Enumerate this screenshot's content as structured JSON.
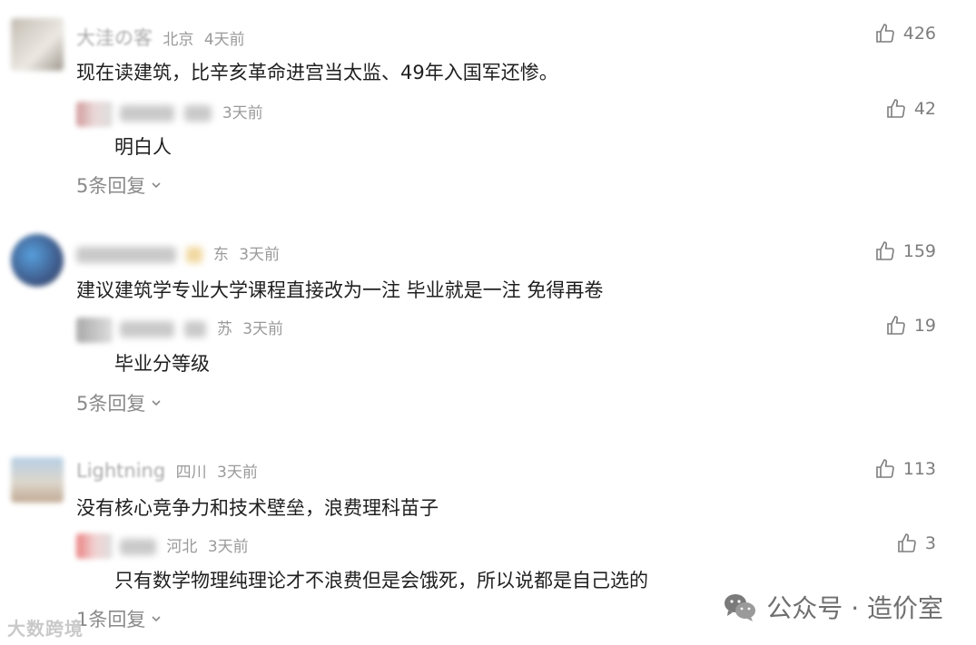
{
  "comments": [
    {
      "user": "大洼の客",
      "location": "北京",
      "time": "4天前",
      "text": "现在读建筑，比辛亥革命进宫当太监、49年入国军还惨。",
      "likes": "426",
      "reply": {
        "location": "",
        "time": "3天前",
        "text": "明白人",
        "likes": "42"
      },
      "more_replies": "5条回复"
    },
    {
      "user": "",
      "location": "东",
      "time": "3天前",
      "text": "建议建筑学专业大学课程直接改为一注 毕业就是一注 免得再卷",
      "likes": "159",
      "reply": {
        "location": "苏",
        "time": "3天前",
        "text": "毕业分等级",
        "likes": "19"
      },
      "more_replies": "5条回复"
    },
    {
      "user": "Lightning",
      "location": "四川",
      "time": "3天前",
      "text": "没有核心竞争力和技术壁垒，浪费理科苗子",
      "likes": "113",
      "reply": {
        "location": "河北",
        "time": "3天前",
        "text": "只有数学物理纯理论才不浪费但是会饿死，所以说都是自己选的",
        "likes": "3"
      },
      "more_replies": "1条回复"
    }
  ],
  "watermark": {
    "wechat_text": "公众号 · 造价室",
    "left_text": "大数跨境"
  },
  "icons": {
    "like": "thumbs-up-icon",
    "expand": "chevron-down-icon",
    "wechat": "wechat-icon"
  },
  "colors": {
    "text": "#1f1f1f",
    "meta": "#999999",
    "icon": "#7d7d7d"
  }
}
